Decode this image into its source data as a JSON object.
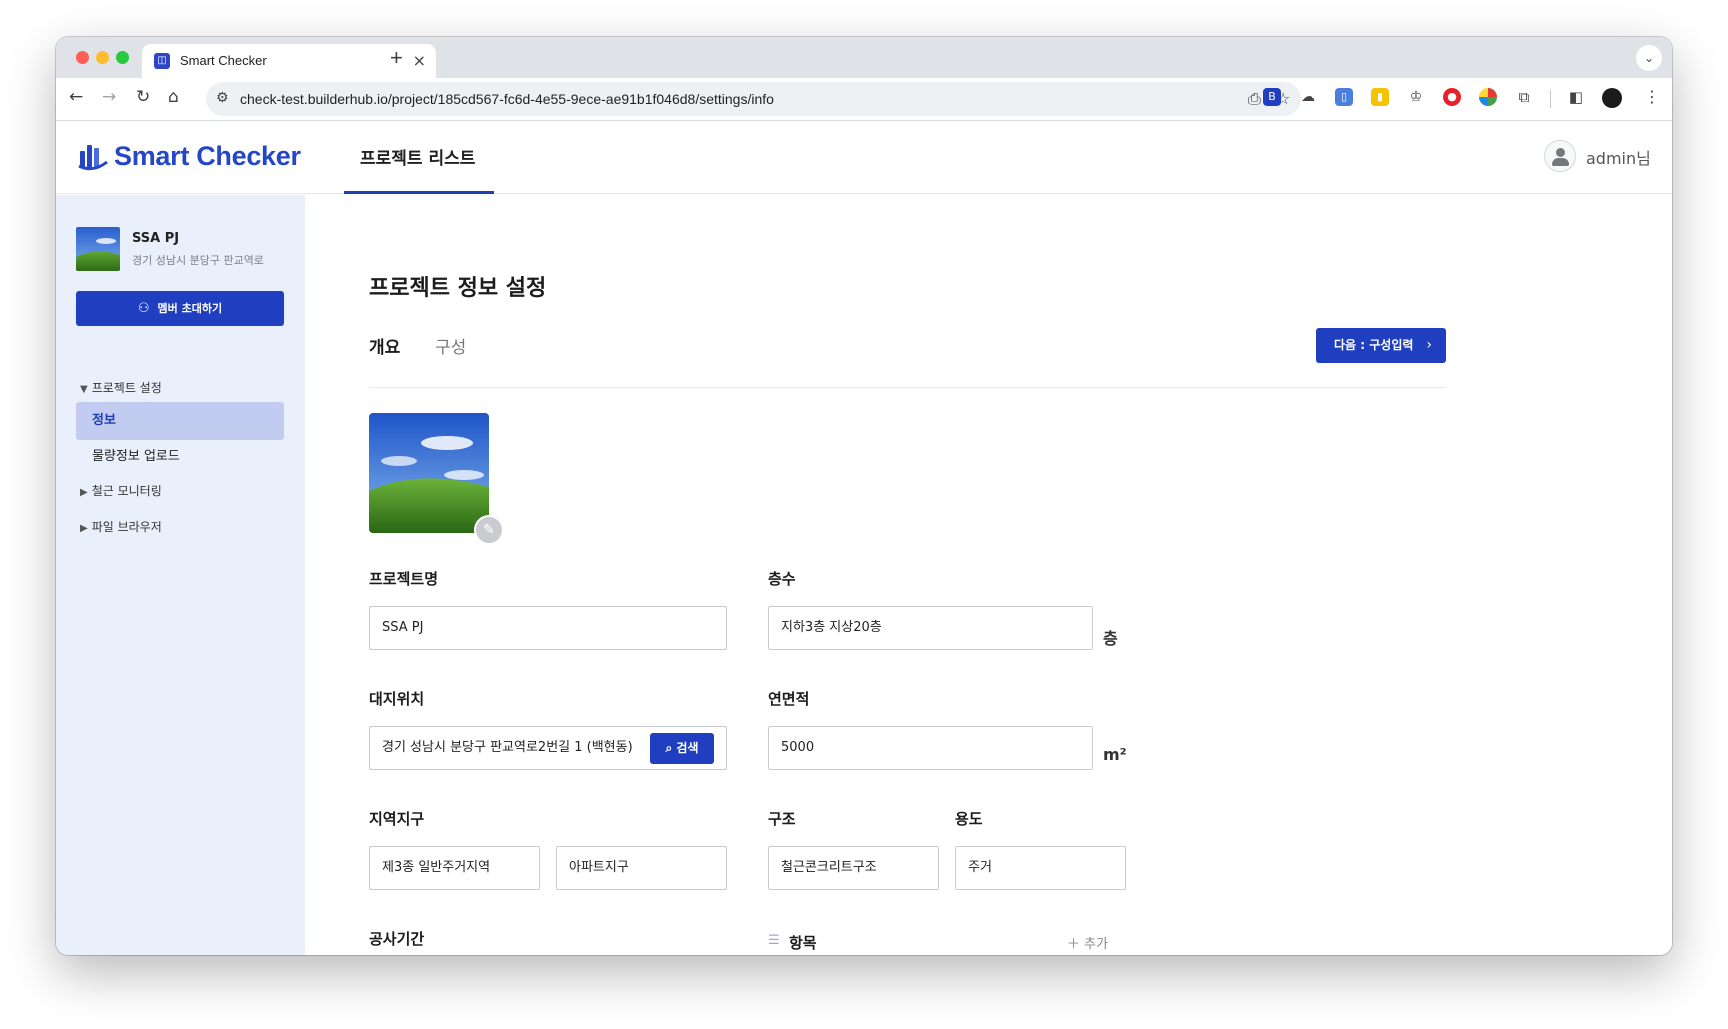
{
  "browser": {
    "tab_title": "Smart Checker",
    "tab_close": "×",
    "new_tab": "+",
    "url": "check-test.builderhub.io/project/185cd567-fc6d-4e55-9ece-ae91b1f046d8/settings/info"
  },
  "header": {
    "logo_text": "Smart Checker",
    "nav_tab": "프로젝트 리스트",
    "user_name": "admin님"
  },
  "sidebar": {
    "project_name": "SSA PJ",
    "project_address": "경기 성남시 분당구 판교역로",
    "invite_label": "멤버 초대하기",
    "groups": [
      {
        "label": "프로젝트 설정",
        "expanded": true
      },
      {
        "label": "철근 모니터링",
        "expanded": false
      },
      {
        "label": "파일 브라우저",
        "expanded": false
      }
    ],
    "items": [
      {
        "label": "정보",
        "active": true
      },
      {
        "label": "물량정보 업로드",
        "active": false
      }
    ],
    "tri_open": "▼",
    "tri_closed": "▶"
  },
  "main": {
    "title": "프로젝트 정보 설정",
    "tabs": [
      {
        "label": "개요",
        "active": true
      },
      {
        "label": "구성",
        "active": false
      }
    ],
    "next_button": "다음 : 구성입력",
    "next_chevron": "›",
    "fields": {
      "project_name": {
        "label": "프로젝트명",
        "value": "SSA PJ"
      },
      "floors": {
        "label": "층수",
        "value": "지하3층 지상20층",
        "unit": "층"
      },
      "site_location": {
        "label": "대지위치",
        "value": "경기 성남시 분당구 판교역로2번길 1 (백현동)",
        "search_label": "검색"
      },
      "total_area": {
        "label": "연면적",
        "value": "5000",
        "unit": "m²"
      },
      "zoning": {
        "label": "지역지구",
        "value1": "제3종 일반주거지역",
        "value2": "아파트지구"
      },
      "structure": {
        "label": "구조",
        "value": "철근콘크리트구조"
      },
      "usage": {
        "label": "용도",
        "value": "주거"
      },
      "construction_period": {
        "label": "공사기간"
      },
      "items": {
        "label": "항목",
        "add_label": "추가"
      }
    }
  },
  "colors": {
    "brand": "#2447c6",
    "button": "#1f3fc0",
    "sidebar_bg": "#e9effb",
    "active_item_bg": "#c2ccf0"
  }
}
